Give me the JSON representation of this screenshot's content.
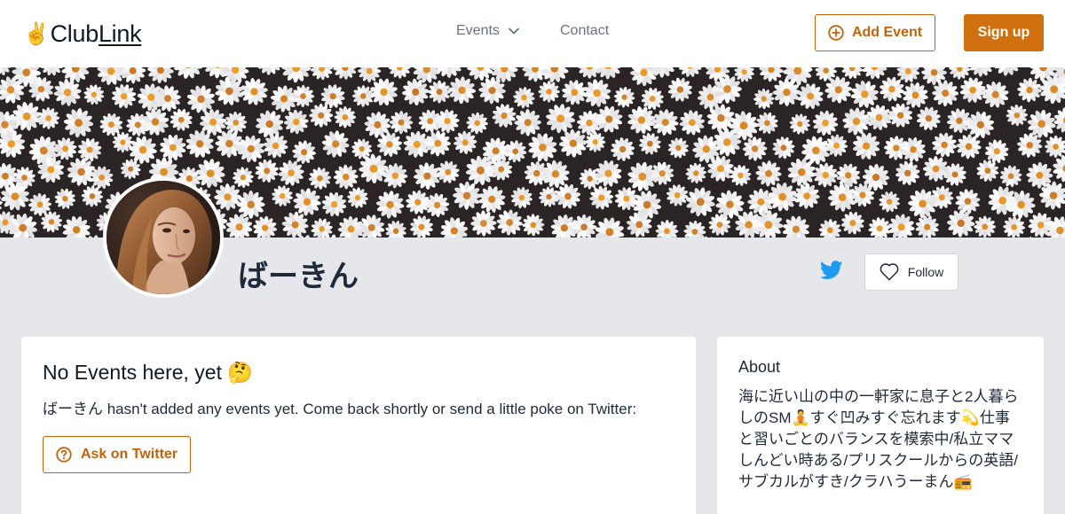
{
  "header": {
    "logo_emoji": "✌️",
    "logo_text_1": "Club",
    "logo_text_2": "Link",
    "nav_events": "Events",
    "nav_contact": "Contact",
    "add_event_label": "Add Event",
    "signup_label": "Sign up"
  },
  "profile": {
    "name": "ばーきん",
    "follow_label": "Follow"
  },
  "events_card": {
    "title": "No Events here, yet 🤔",
    "message": "ばーきん hasn't added any events yet. Come back shortly or send a little poke on Twitter:",
    "ask_label": "Ask on Twitter"
  },
  "about_card": {
    "title": "About",
    "text": "海に近い山の中の一軒家に息子と2人暮らしのSM🧘すぐ凹みすぐ忘れます💫仕事と習いごとのバランスを模索中/私立ママしんどい時ある/プリスクールからの英語/サブカルがすき/クラハうーまん📻"
  },
  "colors": {
    "accent": "#d0700f",
    "twitter": "#1d9bf0",
    "page_bg": "#e5e7eb"
  },
  "icons": {
    "events_chevron": "chevron-down-icon",
    "add_event": "plus-circle-icon",
    "twitter": "twitter-icon",
    "follow": "heart-icon",
    "ask": "question-circle-icon"
  }
}
